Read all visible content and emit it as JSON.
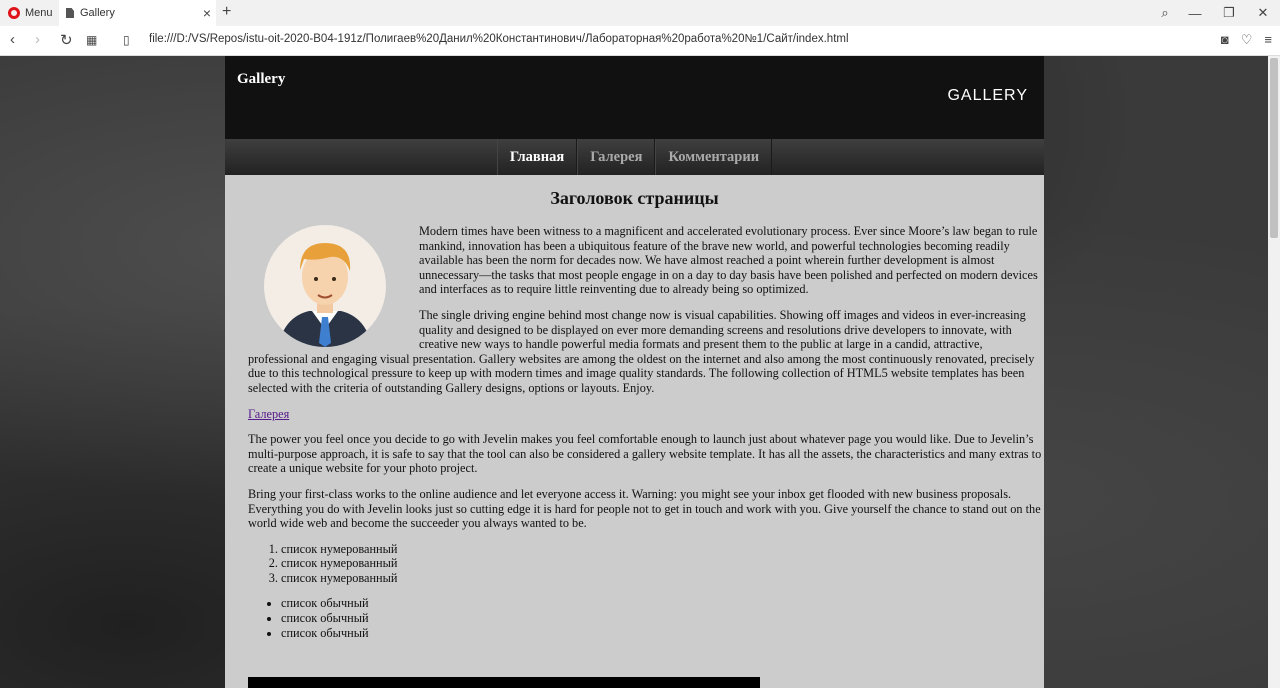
{
  "browser": {
    "menu_label": "Menu",
    "tab_title": "Gallery",
    "url": "file:///D:/VS/Repos/istu-oit-2020-B04-191z/Полигаев%20Данил%20Константинович/Лабораторная%20работа%20№1/Сайт/index.html"
  },
  "site": {
    "title": "Gallery",
    "logo_text": "GALLERY",
    "nav": [
      "Главная",
      "Галерея",
      "Комментарии"
    ],
    "heading": "Заголовок страницы",
    "paragraphs": [
      "Modern times have been witness to a magnificent and accelerated evolutionary process. Ever since Moore’s law began to rule mankind, innovation has been a ubiquitous feature of the brave new world, and powerful technologies becoming readily available has been the norm for decades now. We have almost reached a point wherein further development is almost unnecessary—the tasks that most people engage in on a day to day basis have been polished and perfected on modern devices and interfaces as to require little reinventing due to already being so optimized.",
      "The single driving engine behind most change now is visual capabilities. Showing off images and videos in ever-increasing quality and designed to be displayed on ever more demanding screens and resolutions drive developers to innovate, with creative new ways to handle powerful media formats and present them to the public at large in a candid, attractive, professional and engaging visual presentation. Gallery websites are among the oldest on the internet and also among the most continuously renovated, precisely due to this technological pressure to keep up with modern times and image quality standards. The following collection of HTML5 website templates has been selected with the criteria of outstanding Gallery designs, options or layouts. Enjoy.",
      "The power you feel once you decide to go with Jevelin makes you feel comfortable enough to launch just about whatever page you would like. Due to Jevelin’s multi-purpose approach, it is safe to say that the tool can also be considered a gallery website template. It has all the assets, the characteristics and many extras to create a unique website for your photo project.",
      "Bring your first-class works to the online audience and let everyone access it. Warning: you might see your inbox get flooded with new business proposals. Everything you do with Jevelin looks just so cutting edge it is hard for people not to get in touch and work with you. Give yourself the chance to stand out on the world wide web and become the succeeder you always wanted to be."
    ],
    "gallery_link": "Галерея",
    "ordered_list": [
      "список нумерованный",
      "список нумерованный",
      "список нумерованный"
    ],
    "unordered_list": [
      "список обычный",
      "список обычный",
      "список обычный"
    ]
  }
}
